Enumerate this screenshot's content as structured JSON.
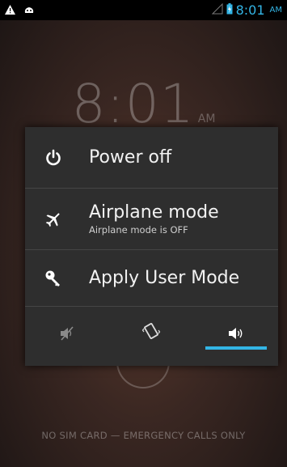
{
  "status_bar": {
    "time": "8:01",
    "ampm": "AM",
    "accent": "#33b5e5",
    "left_icons": [
      "warning-icon",
      "android-debug-icon"
    ],
    "right_icons": [
      "signal-icon",
      "battery-icon"
    ]
  },
  "lockscreen": {
    "clock_time": "8:01",
    "clock_ampm": "AM",
    "emergency_text": "NO SIM CARD — EMERGENCY CALLS ONLY"
  },
  "power_menu": {
    "items": [
      {
        "icon": "power-icon",
        "label": "Power off"
      },
      {
        "icon": "airplane-icon",
        "label": "Airplane mode",
        "sublabel": "Airplane mode is OFF"
      },
      {
        "icon": "key-icon",
        "label": "Apply User Mode"
      }
    ],
    "sound_modes": [
      {
        "icon": "silent-icon",
        "selected": false
      },
      {
        "icon": "vibrate-icon",
        "selected": false
      },
      {
        "icon": "sound-on-icon",
        "selected": true
      }
    ]
  }
}
